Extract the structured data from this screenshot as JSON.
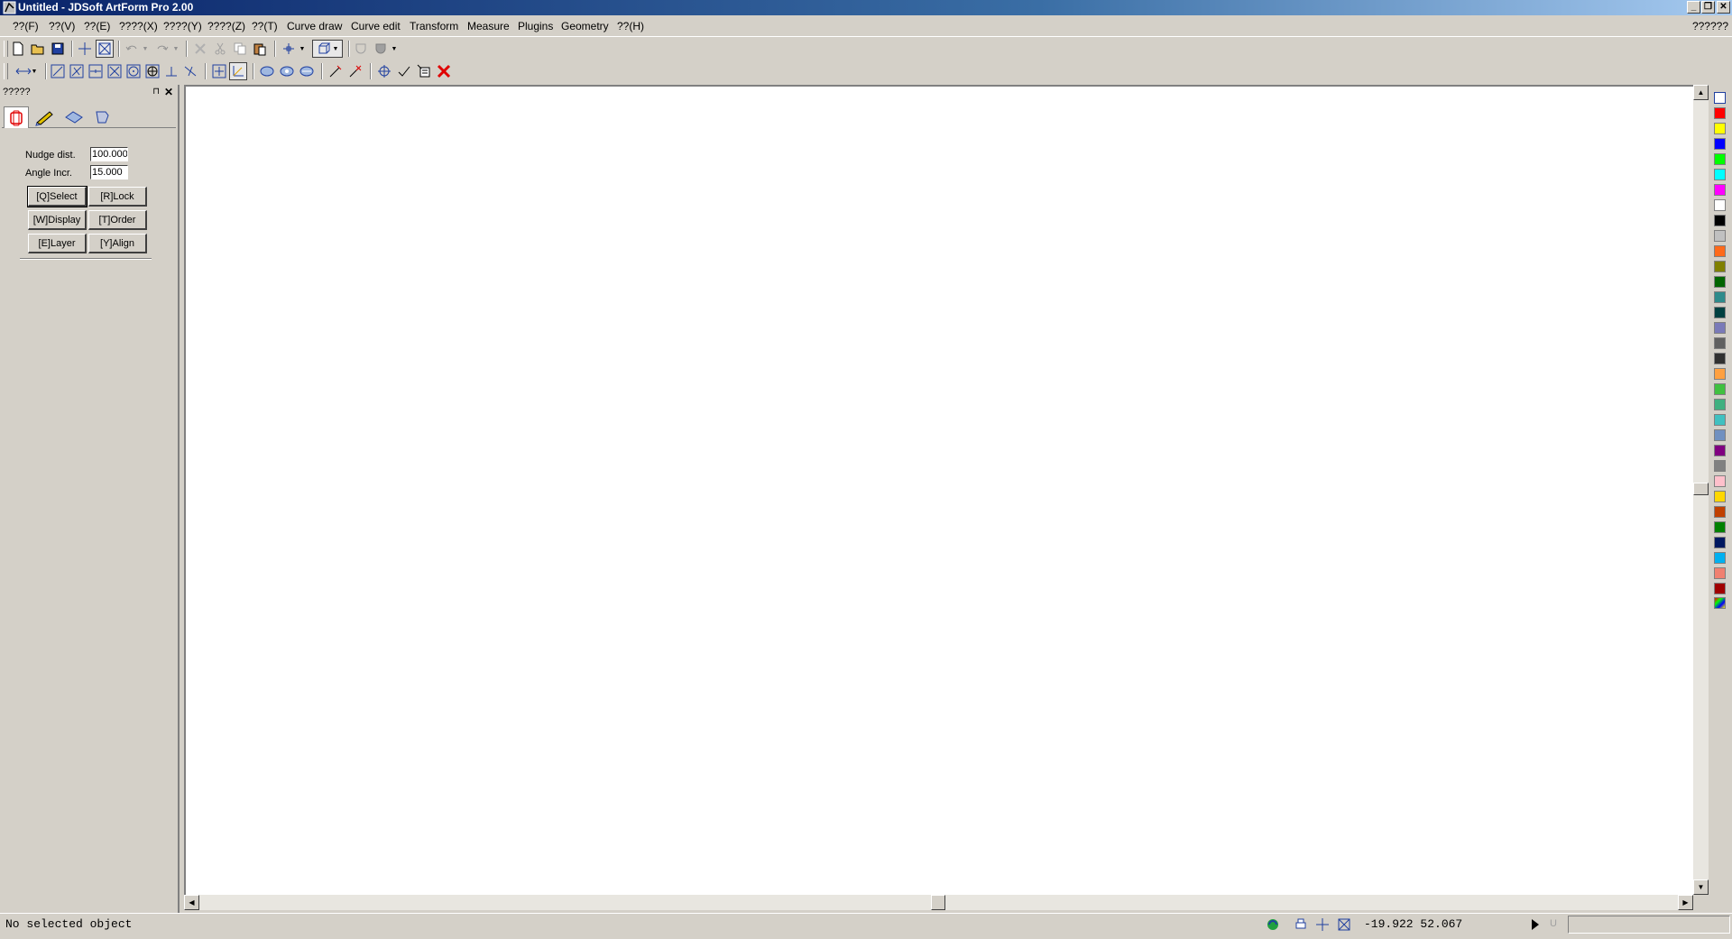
{
  "window": {
    "title": "Untitled - JDSoft ArtForm Pro 2.00"
  },
  "menubar": {
    "items": [
      "??(F)",
      "??(V)",
      "??(E)",
      "????(X)",
      "????(Y)",
      "????(Z)",
      "??(T)",
      "Curve draw",
      "Curve edit",
      "Transform",
      "Measure",
      "Plugins",
      "Geometry",
      "??(H)"
    ],
    "right_label": "??????"
  },
  "panel": {
    "title": "?????",
    "nudge_label": "Nudge dist.",
    "nudge_value": "100.000",
    "angle_label": "Angle Incr.",
    "angle_value": "15.000",
    "buttons": {
      "select": "[Q]Select",
      "lock": "[R]Lock",
      "display": "[W]Display",
      "order": "[T]Order",
      "layer": "[E]Layer",
      "align": "[Y]Align"
    }
  },
  "palette": {
    "colors": [
      "#ff0000",
      "#ffff00",
      "#0000ff",
      "#00ff00",
      "#00ffff",
      "#ff00ff",
      "#ffffff",
      "#000000",
      "#c0c0c0",
      "#ff6a1a",
      "#808000",
      "#006400",
      "#2e8b8b",
      "#004040",
      "#7a7ab8",
      "#606060",
      "#303030",
      "#ffa040",
      "#40c040",
      "#40b080",
      "#40c0c0",
      "#7090c0",
      "#800080",
      "#808080",
      "#ffc0cb",
      "#ffd700",
      "#c04000",
      "#008000",
      "#001860",
      "#00b0f0",
      "#f08070",
      "#a00000"
    ]
  },
  "statusbar": {
    "message": "No selected object",
    "coords": "-19.922 52.067",
    "u_label": "U"
  }
}
